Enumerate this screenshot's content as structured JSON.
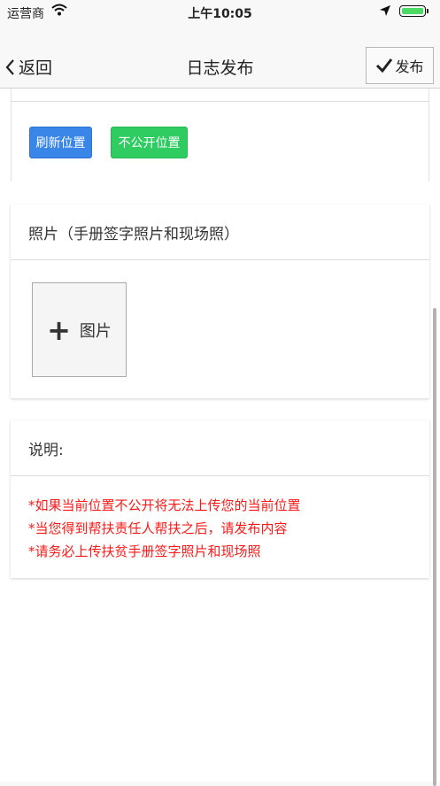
{
  "status_bar": {
    "carrier": "运营商",
    "time": "上午10:05",
    "icons": [
      "wifi-icon",
      "location-arrow-icon",
      "battery-icon"
    ]
  },
  "nav": {
    "back_label": "返回",
    "title": "日志发布",
    "publish_label": "发布"
  },
  "location": {
    "refresh_label": "刷新位置",
    "private_label": "不公开位置"
  },
  "photos": {
    "header": "照片（手册签字照片和现场照）",
    "add_label": "图片"
  },
  "description": {
    "header": "说明:",
    "lines": [
      "*如果当前位置不公开将无法上传您的当前位置",
      "*当您得到帮扶责任人帮扶之后，请发布内容",
      "*请务必上传扶贫手册签字照片和现场照"
    ]
  },
  "colors": {
    "accent_blue": "#3a86e8",
    "accent_green": "#2fcc62",
    "note_red": "#ff1a1a"
  }
}
